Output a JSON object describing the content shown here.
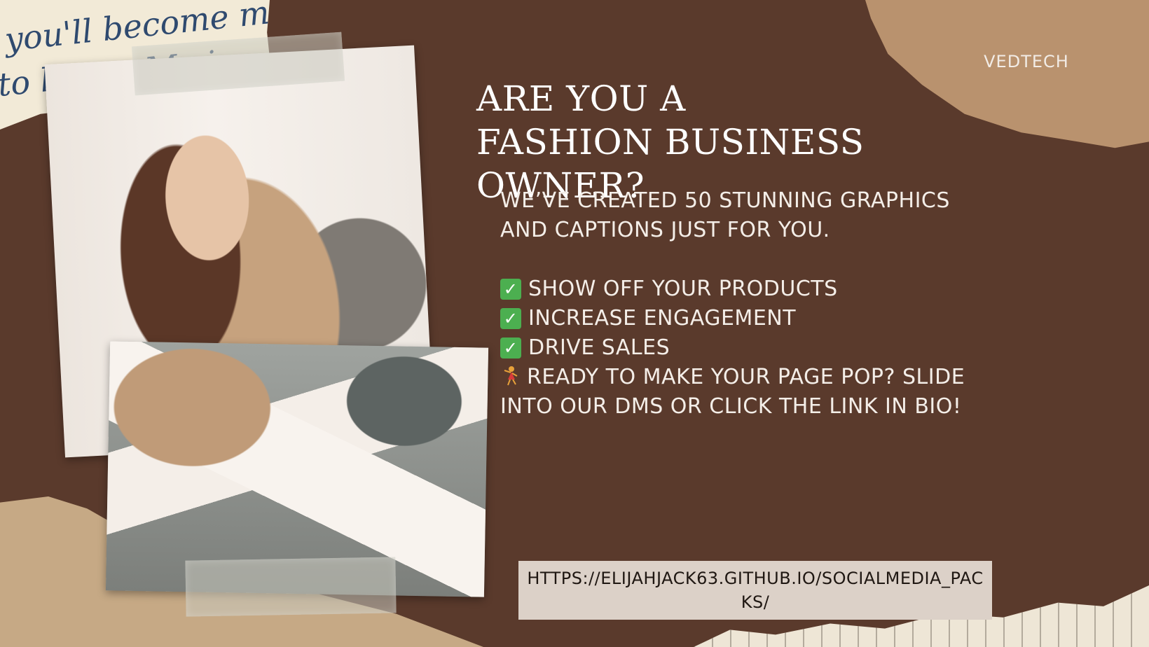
{
  "brand": "VEDTECH",
  "headline": "ARE YOU A FASHION BUSINESS OWNER?",
  "intro": "WE’VE CREATED 50 STUNNING GRAPHICS AND CAPTIONS JUST FOR YOU.",
  "bullets": [
    "SHOW OFF YOUR PRODUCTS",
    "INCREASE ENGAGEMENT",
    "DRIVE SALES"
  ],
  "cta": "READY TO MAKE YOUR PAGE POP? SLIDE INTO OUR DMS OR CLICK THE LINK IN BIO!",
  "link": "HTTPS://ELIJAHJACK63.GITHUB.IO/SOCIALMEDIA_PACKS/",
  "decor": {
    "script_line_1": "you'll become m",
    "script_line_2": "to learn. My i"
  },
  "colors": {
    "background": "#5a3a2c",
    "text": "#f4eee8",
    "link_box": "#dcd1c8",
    "check": "#4caf50"
  }
}
